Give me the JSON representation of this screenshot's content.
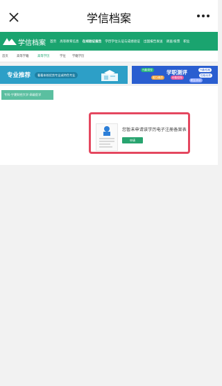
{
  "window": {
    "title": "学信档案"
  },
  "navbar": {
    "logo_text": "学信档案",
    "items": [
      "首页",
      "高等教育信息",
      "在线验证报告",
      "学历学位认证与成绩验证",
      "出国报告发送",
      "调查/投票",
      "职业"
    ],
    "active_index": 2
  },
  "subnav": {
    "items": [
      "首页",
      "高等学籍",
      "高等学历",
      "学位",
      "学籍学历"
    ],
    "active_index": 2
  },
  "banner_left": {
    "title": "专业推荐",
    "subtitle": "看看本校优势专业或特色专业"
  },
  "banner_right": {
    "title": "学职测评",
    "chips": [
      "兴趣/类型",
      "能力/素质",
      "兴趣/性格",
      "价值/目标",
      "性格/优势",
      "职业/评价"
    ]
  },
  "major_tag": {
    "text": "专科-宁夏财经大学-高级医学"
  },
  "card": {
    "title": "您暂未申请该学历电子注册备案表",
    "button_label": "申请"
  },
  "colors": {
    "brand": "#1aa46f",
    "highlight_border": "#e4475f"
  }
}
